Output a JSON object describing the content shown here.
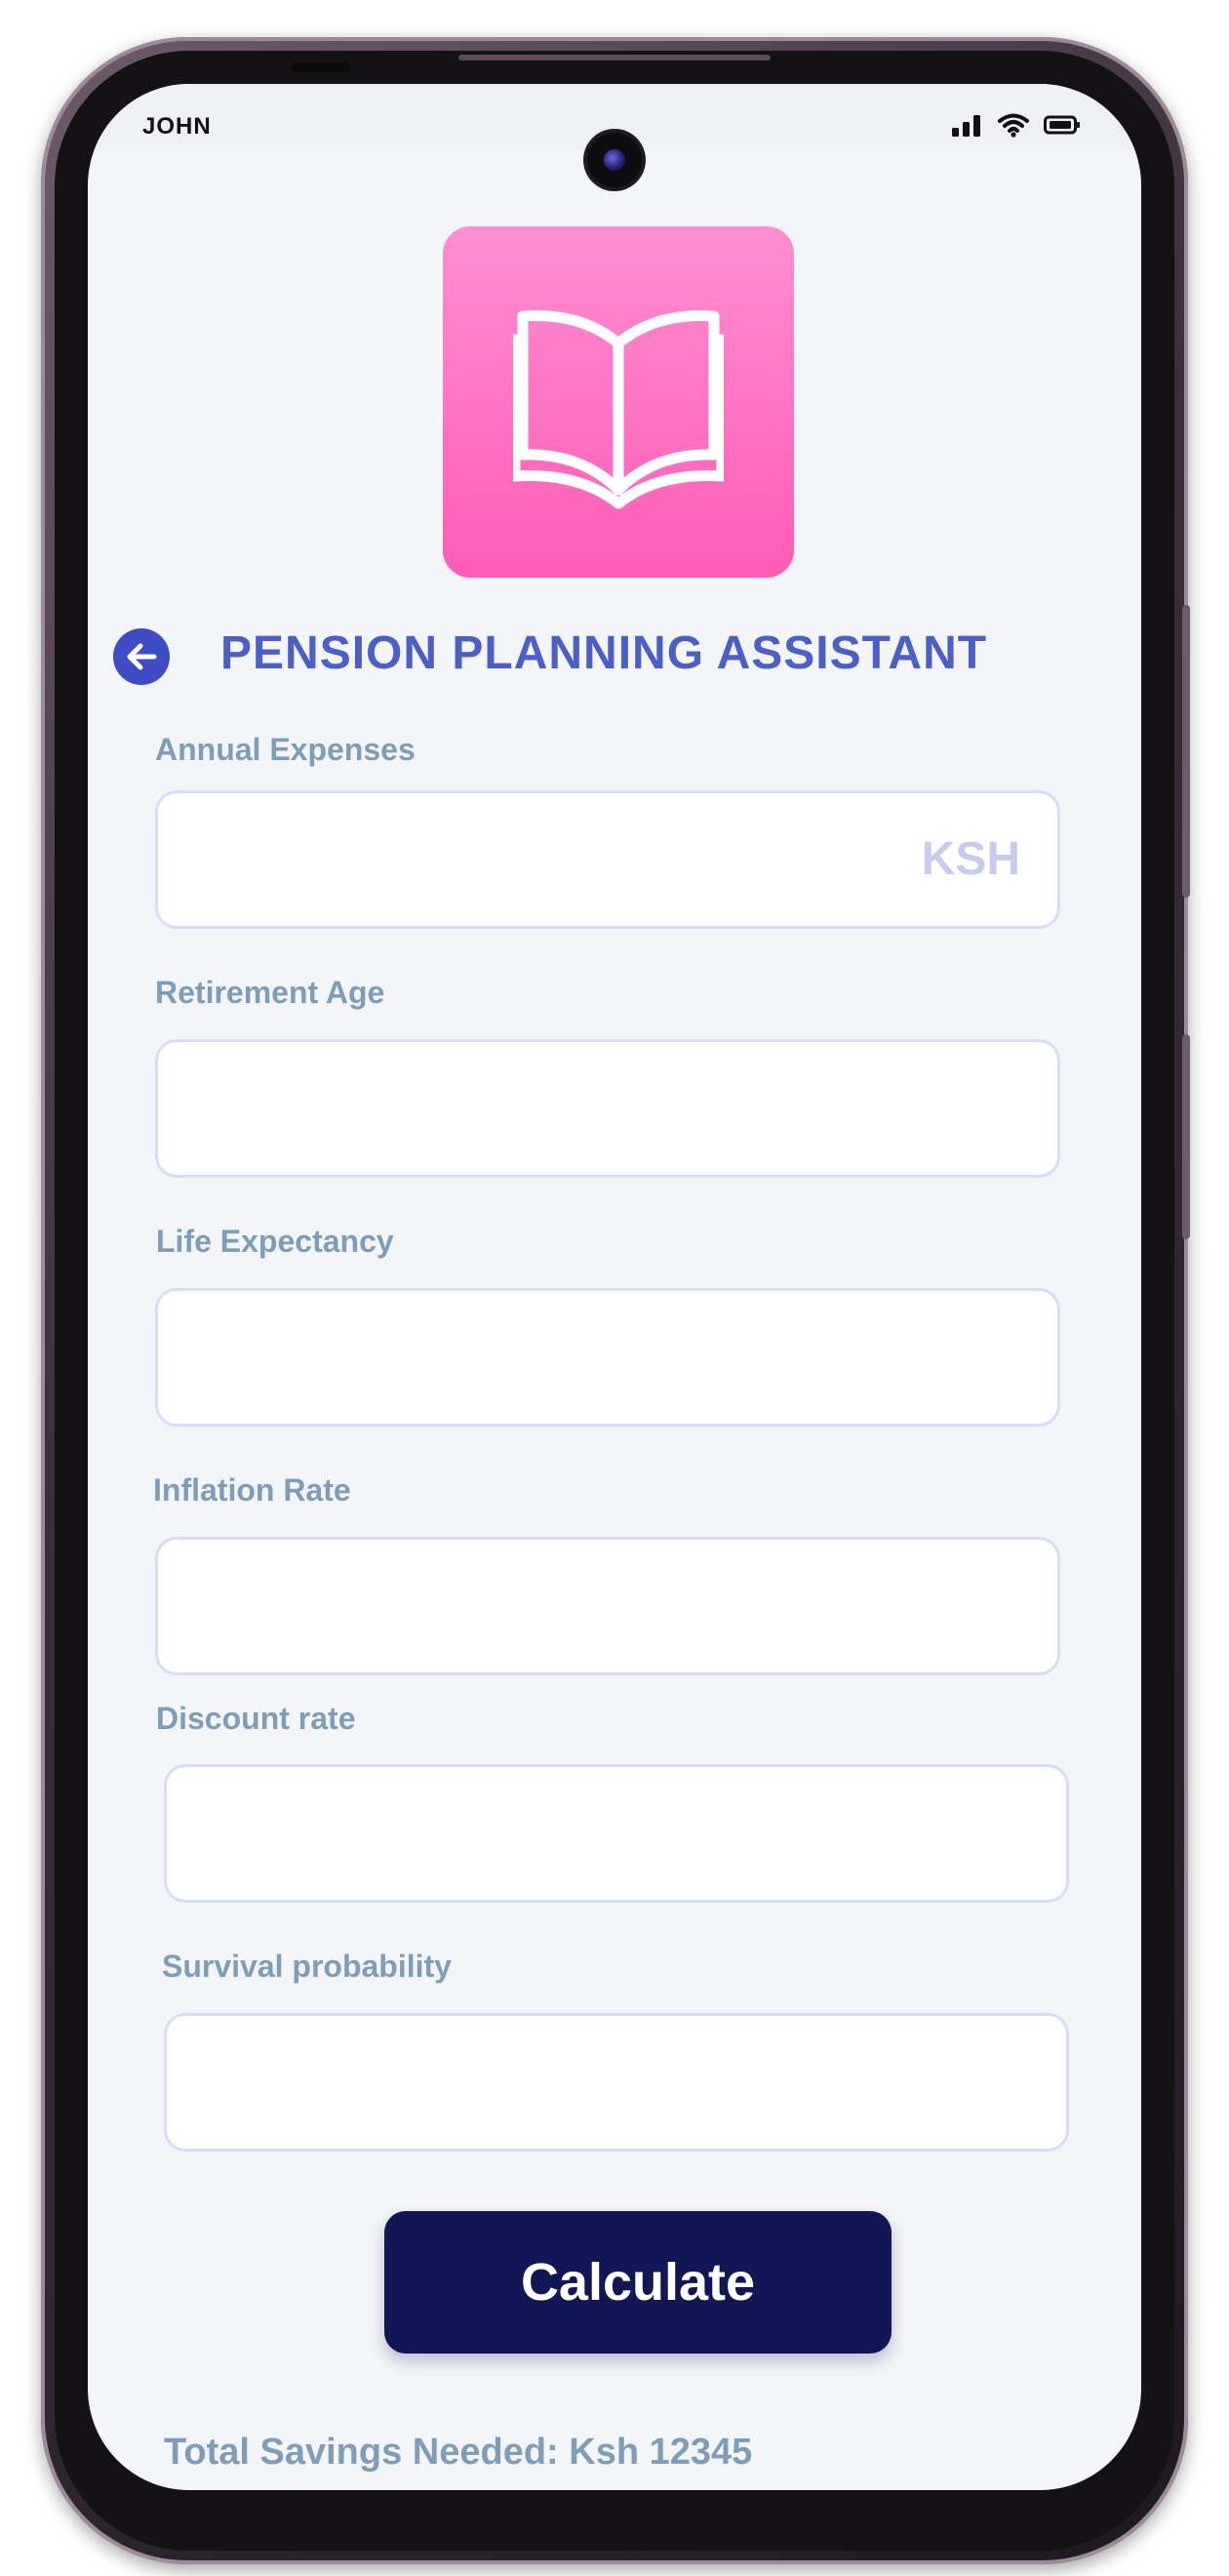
{
  "status_bar": {
    "carrier": "JOHN",
    "icons": [
      "signal-icon",
      "wifi-icon",
      "battery-icon"
    ]
  },
  "app": {
    "logo_icon": "open-book-icon",
    "logo_color": "#ff6ec2",
    "title": "PENSION PLANNING ASSISTANT",
    "back_icon": "arrow-left-icon",
    "accent_color": "#3e4dc4"
  },
  "form": {
    "fields": [
      {
        "label": "Annual Expenses",
        "value": "",
        "suffix": "KSH"
      },
      {
        "label": "Retirement Age",
        "value": "",
        "suffix": ""
      },
      {
        "label": "Life Expectancy",
        "value": "",
        "suffix": ""
      },
      {
        "label": "Inflation Rate",
        "value": "",
        "suffix": ""
      },
      {
        "label": "Discount rate",
        "value": "",
        "suffix": ""
      },
      {
        "label": "Survival probability",
        "value": "",
        "suffix": ""
      }
    ],
    "calculate_label": "Calculate",
    "button_color": "#111654"
  },
  "result": {
    "text": "Total Savings Needed: Ksh 12345"
  }
}
